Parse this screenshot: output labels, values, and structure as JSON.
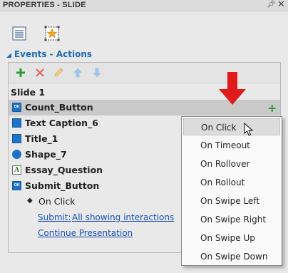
{
  "window": {
    "title": "PROPERTIES - SLIDE",
    "pin_icon": "pin-icon",
    "close_icon": "close-icon"
  },
  "tabs": [
    {
      "icon": "properties-list-icon"
    },
    {
      "icon": "effects-star-icon"
    }
  ],
  "section": {
    "title": "Events - Actions",
    "expanded": true
  },
  "toolbar": {
    "buttons": [
      {
        "icon": "add-icon",
        "color": "#2e9b2e"
      },
      {
        "icon": "delete-icon",
        "color": "#e06060"
      },
      {
        "icon": "edit-icon",
        "color": "#f0c070"
      },
      {
        "icon": "move-up-icon",
        "color": "#9ec4ea"
      },
      {
        "icon": "move-down-icon",
        "color": "#9ec4ea"
      }
    ]
  },
  "tree": {
    "slide_label": "Slide 1",
    "items": [
      {
        "label": "Count_Button",
        "icon": "button-object-icon",
        "icon_text": "OK",
        "selected": true,
        "add_action": "+"
      },
      {
        "label": "Text Caption_6",
        "icon": "text-caption-icon"
      },
      {
        "label": "Title_1",
        "icon": "title-icon"
      },
      {
        "label": "Shape_7",
        "icon": "shape-icon"
      },
      {
        "label": "Essay_Question",
        "icon": "essay-question-icon",
        "icon_text": "A"
      },
      {
        "label": "Submit_Button",
        "icon": "button-object-icon",
        "icon_text": "OK"
      }
    ],
    "event": {
      "label": "On Click",
      "actions": [
        {
          "label": "Submit:",
          "target": "All showing interactions"
        },
        {
          "label": "Continue Presentation"
        }
      ]
    }
  },
  "menu": {
    "hovered_index": 0,
    "items": [
      "On Click",
      "On Timeout",
      "On Rollover",
      "On Rollout",
      "On Swipe Left",
      "On Swipe Right",
      "On Swipe Up",
      "On Swipe Down"
    ]
  },
  "colors": {
    "accent_blue": "#1e6cb3",
    "link_blue": "#1750b5",
    "selection_gray": "#c9c9c9",
    "arrow_red": "#e01b1b"
  }
}
